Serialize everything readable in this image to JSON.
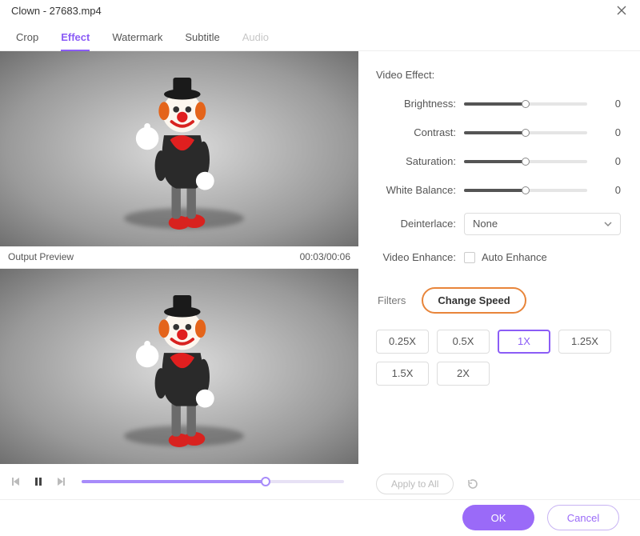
{
  "window": {
    "title": "Clown - 27683.mp4"
  },
  "tabs": [
    {
      "label": "Crop",
      "active": false,
      "disabled": false
    },
    {
      "label": "Effect",
      "active": true,
      "disabled": false
    },
    {
      "label": "Watermark",
      "active": false,
      "disabled": false
    },
    {
      "label": "Subtitle",
      "active": false,
      "disabled": false
    },
    {
      "label": "Audio",
      "active": false,
      "disabled": true
    }
  ],
  "previewLabel": "Output Preview",
  "timecode": "00:03/00:06",
  "videoEffect": {
    "title": "Video Effect:",
    "brightness": {
      "label": "Brightness:",
      "value": 0,
      "pos": 50
    },
    "contrast": {
      "label": "Contrast:",
      "value": 0,
      "pos": 50
    },
    "saturation": {
      "label": "Saturation:",
      "value": 0,
      "pos": 50
    },
    "whiteBalance": {
      "label": "White Balance:",
      "value": 0,
      "pos": 50
    },
    "deinterlace": {
      "label": "Deinterlace:",
      "selected": "None"
    },
    "enhance": {
      "label": "Video Enhance:",
      "checkboxLabel": "Auto Enhance",
      "checked": false
    }
  },
  "subTabs": {
    "filters": "Filters",
    "changeSpeed": "Change Speed"
  },
  "speeds": [
    {
      "label": "0.25X",
      "selected": false
    },
    {
      "label": "0.5X",
      "selected": false
    },
    {
      "label": "1X",
      "selected": true
    },
    {
      "label": "1.25X",
      "selected": false
    },
    {
      "label": "1.5X",
      "selected": false
    },
    {
      "label": "2X",
      "selected": false
    }
  ],
  "applyAll": "Apply to All",
  "footer": {
    "ok": "OK",
    "cancel": "Cancel"
  },
  "colors": {
    "accent": "#8b5cf6",
    "pillBorder": "#e8853a"
  }
}
